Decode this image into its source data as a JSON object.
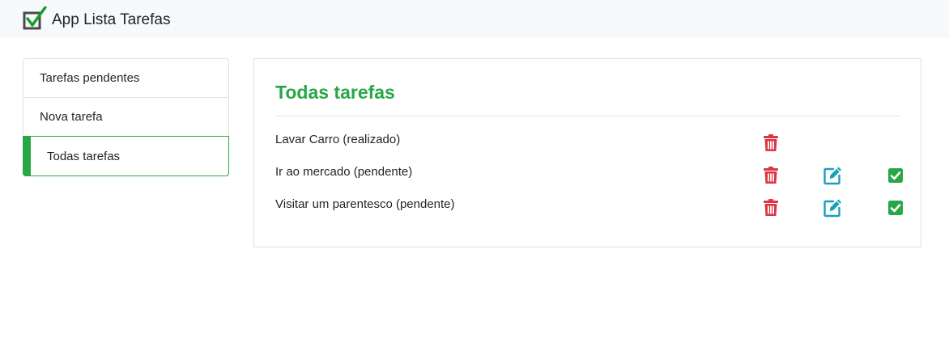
{
  "navbar": {
    "brand_icon": "checkbox-check-icon",
    "title": "App Lista Tarefas"
  },
  "menu": {
    "items": [
      {
        "label": "Tarefas pendentes",
        "active": false
      },
      {
        "label": "Nova tarefa",
        "active": false
      },
      {
        "label": "Todas tarefas",
        "active": true
      }
    ]
  },
  "main": {
    "title": "Todas tarefas",
    "tasks": [
      {
        "text": "Lavar Carro (realizado)",
        "actions": [
          "trash-icon"
        ]
      },
      {
        "text": "Ir ao mercado (pendente)",
        "actions": [
          "trash-icon",
          "edit-icon",
          "check-square-icon"
        ]
      },
      {
        "text": "Visitar um parentesco (pendente)",
        "actions": [
          "trash-icon",
          "edit-icon",
          "check-square-icon"
        ]
      }
    ]
  },
  "colors": {
    "accent": "#28a745",
    "danger": "#dc3545",
    "info": "#17a2b8",
    "navbar_bg": "#f8f9fa"
  }
}
